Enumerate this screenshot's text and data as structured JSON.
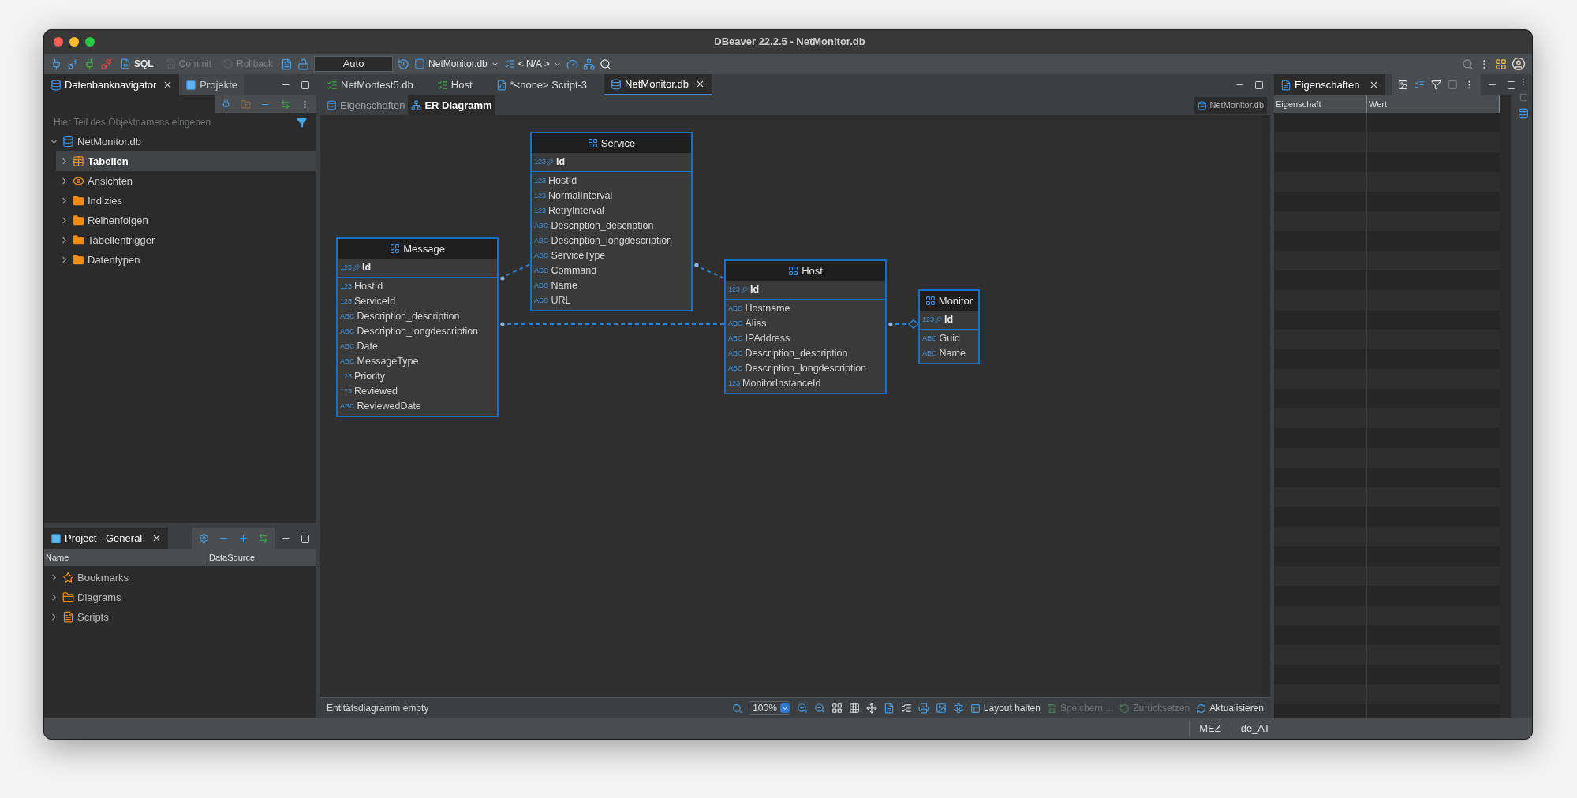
{
  "window": {
    "title": "DBeaver 22.2.5 - NetMonitor.db"
  },
  "toolbar": {
    "buttons": [
      {
        "label": "SQL",
        "disabled": false
      },
      {
        "label": "Commit",
        "disabled": true
      },
      {
        "label": "Rollback",
        "disabled": true
      }
    ],
    "transaction_mode": "Auto",
    "datasource": "NetMonitor.db",
    "schema": "< N/A >"
  },
  "navigator": {
    "tabs": [
      {
        "label": "Datenbanknavigator",
        "selected": true
      },
      {
        "label": "Projekte",
        "selected": false
      }
    ],
    "filter": {
      "placeholder": "Hier Teil des Objektnamens eingeben"
    },
    "tree": [
      {
        "label": "NetMonitor.db",
        "kind": "database",
        "expanded": true,
        "selected": false,
        "children": [
          {
            "label": "Tabellen",
            "kind": "tables",
            "expanded": false,
            "selected": true
          },
          {
            "label": "Ansichten",
            "kind": "views",
            "expanded": false,
            "selected": false
          },
          {
            "label": "Indizies",
            "kind": "folder",
            "expanded": false,
            "selected": false
          },
          {
            "label": "Reihenfolgen",
            "kind": "folder",
            "expanded": false,
            "selected": false
          },
          {
            "label": "Tabellentrigger",
            "kind": "folder",
            "expanded": false,
            "selected": false
          },
          {
            "label": "Datentypen",
            "kind": "folder",
            "expanded": false,
            "selected": false
          }
        ]
      }
    ]
  },
  "project": {
    "tab": "Project - General",
    "columns": [
      "Name",
      "DataSource"
    ],
    "tree": [
      {
        "label": "Bookmarks",
        "kind": "bookmarks",
        "expanded": false,
        "selected": false
      },
      {
        "label": "Diagrams",
        "kind": "diagrams",
        "expanded": false,
        "selected": false
      },
      {
        "label": "Scripts",
        "kind": "scripts",
        "expanded": false,
        "selected": false
      }
    ]
  },
  "editor": {
    "tabs": [
      {
        "label": "NetMontest5.db",
        "kind": "list",
        "selected": false
      },
      {
        "label": "Host",
        "kind": "list",
        "selected": false
      },
      {
        "label": "*<none> Script-3",
        "kind": "script",
        "selected": false
      },
      {
        "label": "NetMonitor.db",
        "kind": "database",
        "selected": true
      }
    ],
    "subtabs": [
      {
        "label": "Eigenschaften",
        "selected": false
      },
      {
        "label": "ER Diagramm",
        "selected": true
      }
    ],
    "datasource": "NetMonitor.db",
    "entities": [
      {
        "name": "Message",
        "attributes": [
          {
            "type_icon": "123",
            "name": "Id",
            "key": true
          },
          {
            "type_icon": "123",
            "name": "HostId",
            "key": false
          },
          {
            "type_icon": "123",
            "name": "ServiceId",
            "key": false
          },
          {
            "type_icon": "ABC",
            "name": "Description_description",
            "key": false
          },
          {
            "type_icon": "ABC",
            "name": "Description_longdescription",
            "key": false
          },
          {
            "type_icon": "ABC",
            "name": "Date",
            "key": false
          },
          {
            "type_icon": "ABC",
            "name": "MessageType",
            "key": false
          },
          {
            "type_icon": "123",
            "name": "Priority",
            "key": false
          },
          {
            "type_icon": "123",
            "name": "Reviewed",
            "key": false
          },
          {
            "type_icon": "ABC",
            "name": "ReviewedDate",
            "key": false
          }
        ]
      },
      {
        "name": "Service",
        "attributes": [
          {
            "type_icon": "123",
            "name": "Id",
            "key": true
          },
          {
            "type_icon": "123",
            "name": "HostId",
            "key": false
          },
          {
            "type_icon": "123",
            "name": "NormalInterval",
            "key": false
          },
          {
            "type_icon": "123",
            "name": "RetryInterval",
            "key": false
          },
          {
            "type_icon": "ABC",
            "name": "Description_description",
            "key": false
          },
          {
            "type_icon": "ABC",
            "name": "Description_longdescription",
            "key": false
          },
          {
            "type_icon": "ABC",
            "name": "ServiceType",
            "key": false
          },
          {
            "type_icon": "ABC",
            "name": "Command",
            "key": false
          },
          {
            "type_icon": "ABC",
            "name": "Name",
            "key": false
          },
          {
            "type_icon": "ABC",
            "name": "URL",
            "key": false
          }
        ]
      },
      {
        "name": "Host",
        "attributes": [
          {
            "type_icon": "123",
            "name": "Id",
            "key": true
          },
          {
            "type_icon": "ABC",
            "name": "Hostname",
            "key": false
          },
          {
            "type_icon": "ABC",
            "name": "Alias",
            "key": false
          },
          {
            "type_icon": "ABC",
            "name": "IPAddress",
            "key": false
          },
          {
            "type_icon": "ABC",
            "name": "Description_description",
            "key": false
          },
          {
            "type_icon": "ABC",
            "name": "Description_longdescription",
            "key": false
          },
          {
            "type_icon": "123",
            "name": "MonitorInstanceId",
            "key": false
          }
        ]
      },
      {
        "name": "Monitor",
        "attributes": [
          {
            "type_icon": "123",
            "name": "Id",
            "key": true
          },
          {
            "type_icon": "ABC",
            "name": "Guid",
            "key": false
          },
          {
            "type_icon": "ABC",
            "name": "Name",
            "key": false
          }
        ]
      }
    ],
    "status": "Entitätsdiagramm empty",
    "zoom": "100%",
    "actions": [
      {
        "label": "Layout halten",
        "kind": "layout",
        "disabled": false
      },
      {
        "label": "Speichern ...",
        "kind": "save",
        "disabled": true
      },
      {
        "label": "Zurücksetzen",
        "kind": "reset",
        "disabled": true
      },
      {
        "label": "Aktualisieren",
        "kind": "refresh",
        "disabled": false
      }
    ]
  },
  "properties": {
    "tab": "Eigenschaften",
    "columns": [
      "Eigenschaft",
      "Wert"
    ]
  },
  "status_bar": [
    "MEZ",
    "de_AT"
  ]
}
